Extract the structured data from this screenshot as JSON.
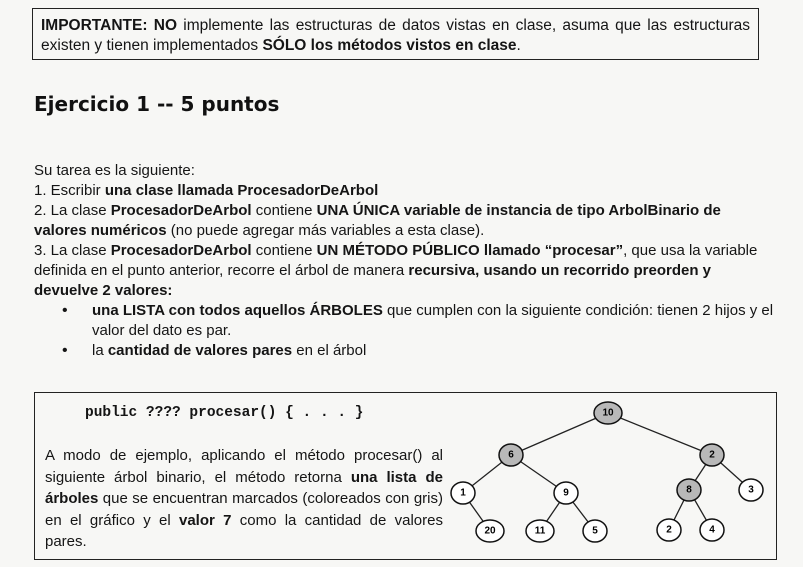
{
  "notice": {
    "label": "IMPORTANTE:",
    "no": "NO",
    "text1": " implemente las estructuras de datos vistas en clase, asuma que las estructuras existen y tienen implementados ",
    "bold_end": "SÓLO los métodos vistos en clase",
    "period": "."
  },
  "exercise": {
    "title": "Ejercicio 1 -- 5 puntos",
    "intro": "Su tarea es la siguiente:",
    "p1_a": "1. Escribir ",
    "p1_b": "una clase llamada ProcesadorDeArbol",
    "p2_a": "2. La clase ",
    "p2_b": "ProcesadorDeArbol",
    "p2_c": " contiene ",
    "p2_d": "UNA ÚNICA variable de instancia de tipo ArbolBinario de valores numéricos",
    "p2_e": " (no puede agregar más variables a esta clase).",
    "p3_a": "3. La clase ",
    "p3_b": "ProcesadorDeArbol",
    "p3_c": " contiene ",
    "p3_d": "UN MÉTODO PÚBLICO llamado “procesar”",
    "p3_e": ", que usa la variable definida en el punto anterior, recorre el árbol de manera ",
    "p3_f": "recursiva, usando un recorrido preorden y devuelve 2 valores:",
    "b1_a": "una LISTA con todos aquellos ÁRBOLES",
    "b1_b": " que cumplen con la siguiente condición: tienen 2 hijos y el valor del dato es par.",
    "b2_a": "la ",
    "b2_b": "cantidad de valores pares",
    "b2_c": " en el árbol"
  },
  "example": {
    "code": "public ???? procesar() { . . . }",
    "d1": "A modo de ejemplo, aplicando el método procesar() al siguiente árbol binario, el método retorna ",
    "d2": "una lista de árboles",
    "d3": " que se encuentran marcados (coloreados con gris) en el gráfico y el ",
    "d4": "valor 7",
    "d5": " como la cantidad de valores pares."
  },
  "tree": {
    "marked_color": "#b8b8b8",
    "nodes": [
      {
        "id": "n10",
        "label": "10",
        "marked": true
      },
      {
        "id": "n6",
        "label": "6",
        "marked": true
      },
      {
        "id": "n2a",
        "label": "2",
        "marked": true
      },
      {
        "id": "n1",
        "label": "1",
        "marked": false
      },
      {
        "id": "n9",
        "label": "9",
        "marked": false
      },
      {
        "id": "n8",
        "label": "8",
        "marked": true
      },
      {
        "id": "n3",
        "label": "3",
        "marked": false
      },
      {
        "id": "n20",
        "label": "20",
        "marked": false
      },
      {
        "id": "n11",
        "label": "11",
        "marked": false
      },
      {
        "id": "n5",
        "label": "5",
        "marked": false
      },
      {
        "id": "n2b",
        "label": "2",
        "marked": false
      },
      {
        "id": "n4",
        "label": "4",
        "marked": false
      }
    ]
  }
}
